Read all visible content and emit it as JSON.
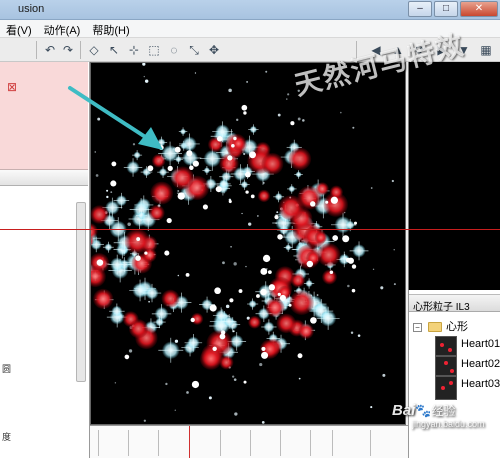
{
  "window": {
    "title": "usion"
  },
  "menu": [
    {
      "label": "看(V)"
    },
    {
      "label": "动作(A)"
    },
    {
      "label": "帮助(H)"
    }
  ],
  "toolbar": {
    "icons": [
      "undo-icon",
      "redo-icon",
      "box-icon",
      "cursor-arrow-icon",
      "move-vertex-icon",
      "select-icon",
      "lasso-icon",
      "scale-icon",
      "move-icon",
      "arrow-left-icon",
      "arrow-up-icon",
      "rotate-icon",
      "arrow-right-icon",
      "arrow-down-icon",
      "grid-icon"
    ]
  },
  "left_panel": {
    "side_chars": [
      "圆",
      "度"
    ]
  },
  "particle_library": {
    "title": "心形粒子 IL3",
    "folder": {
      "label": "心形",
      "expander": "−"
    },
    "items": [
      {
        "label": "Heart01"
      },
      {
        "label": "Heart02"
      },
      {
        "label": "Heart03"
      }
    ]
  },
  "watermark": {
    "text": "天然河马特效",
    "baidu_logo": "Bai",
    "baidu_suffix": "经验",
    "url": "jingyan.baidu.com"
  },
  "colors": {
    "viewport_bg": "#000000",
    "guide_line": "#c81e1e",
    "selection_panel": "#f9d9d9",
    "arrow": "#3fbcc4"
  }
}
